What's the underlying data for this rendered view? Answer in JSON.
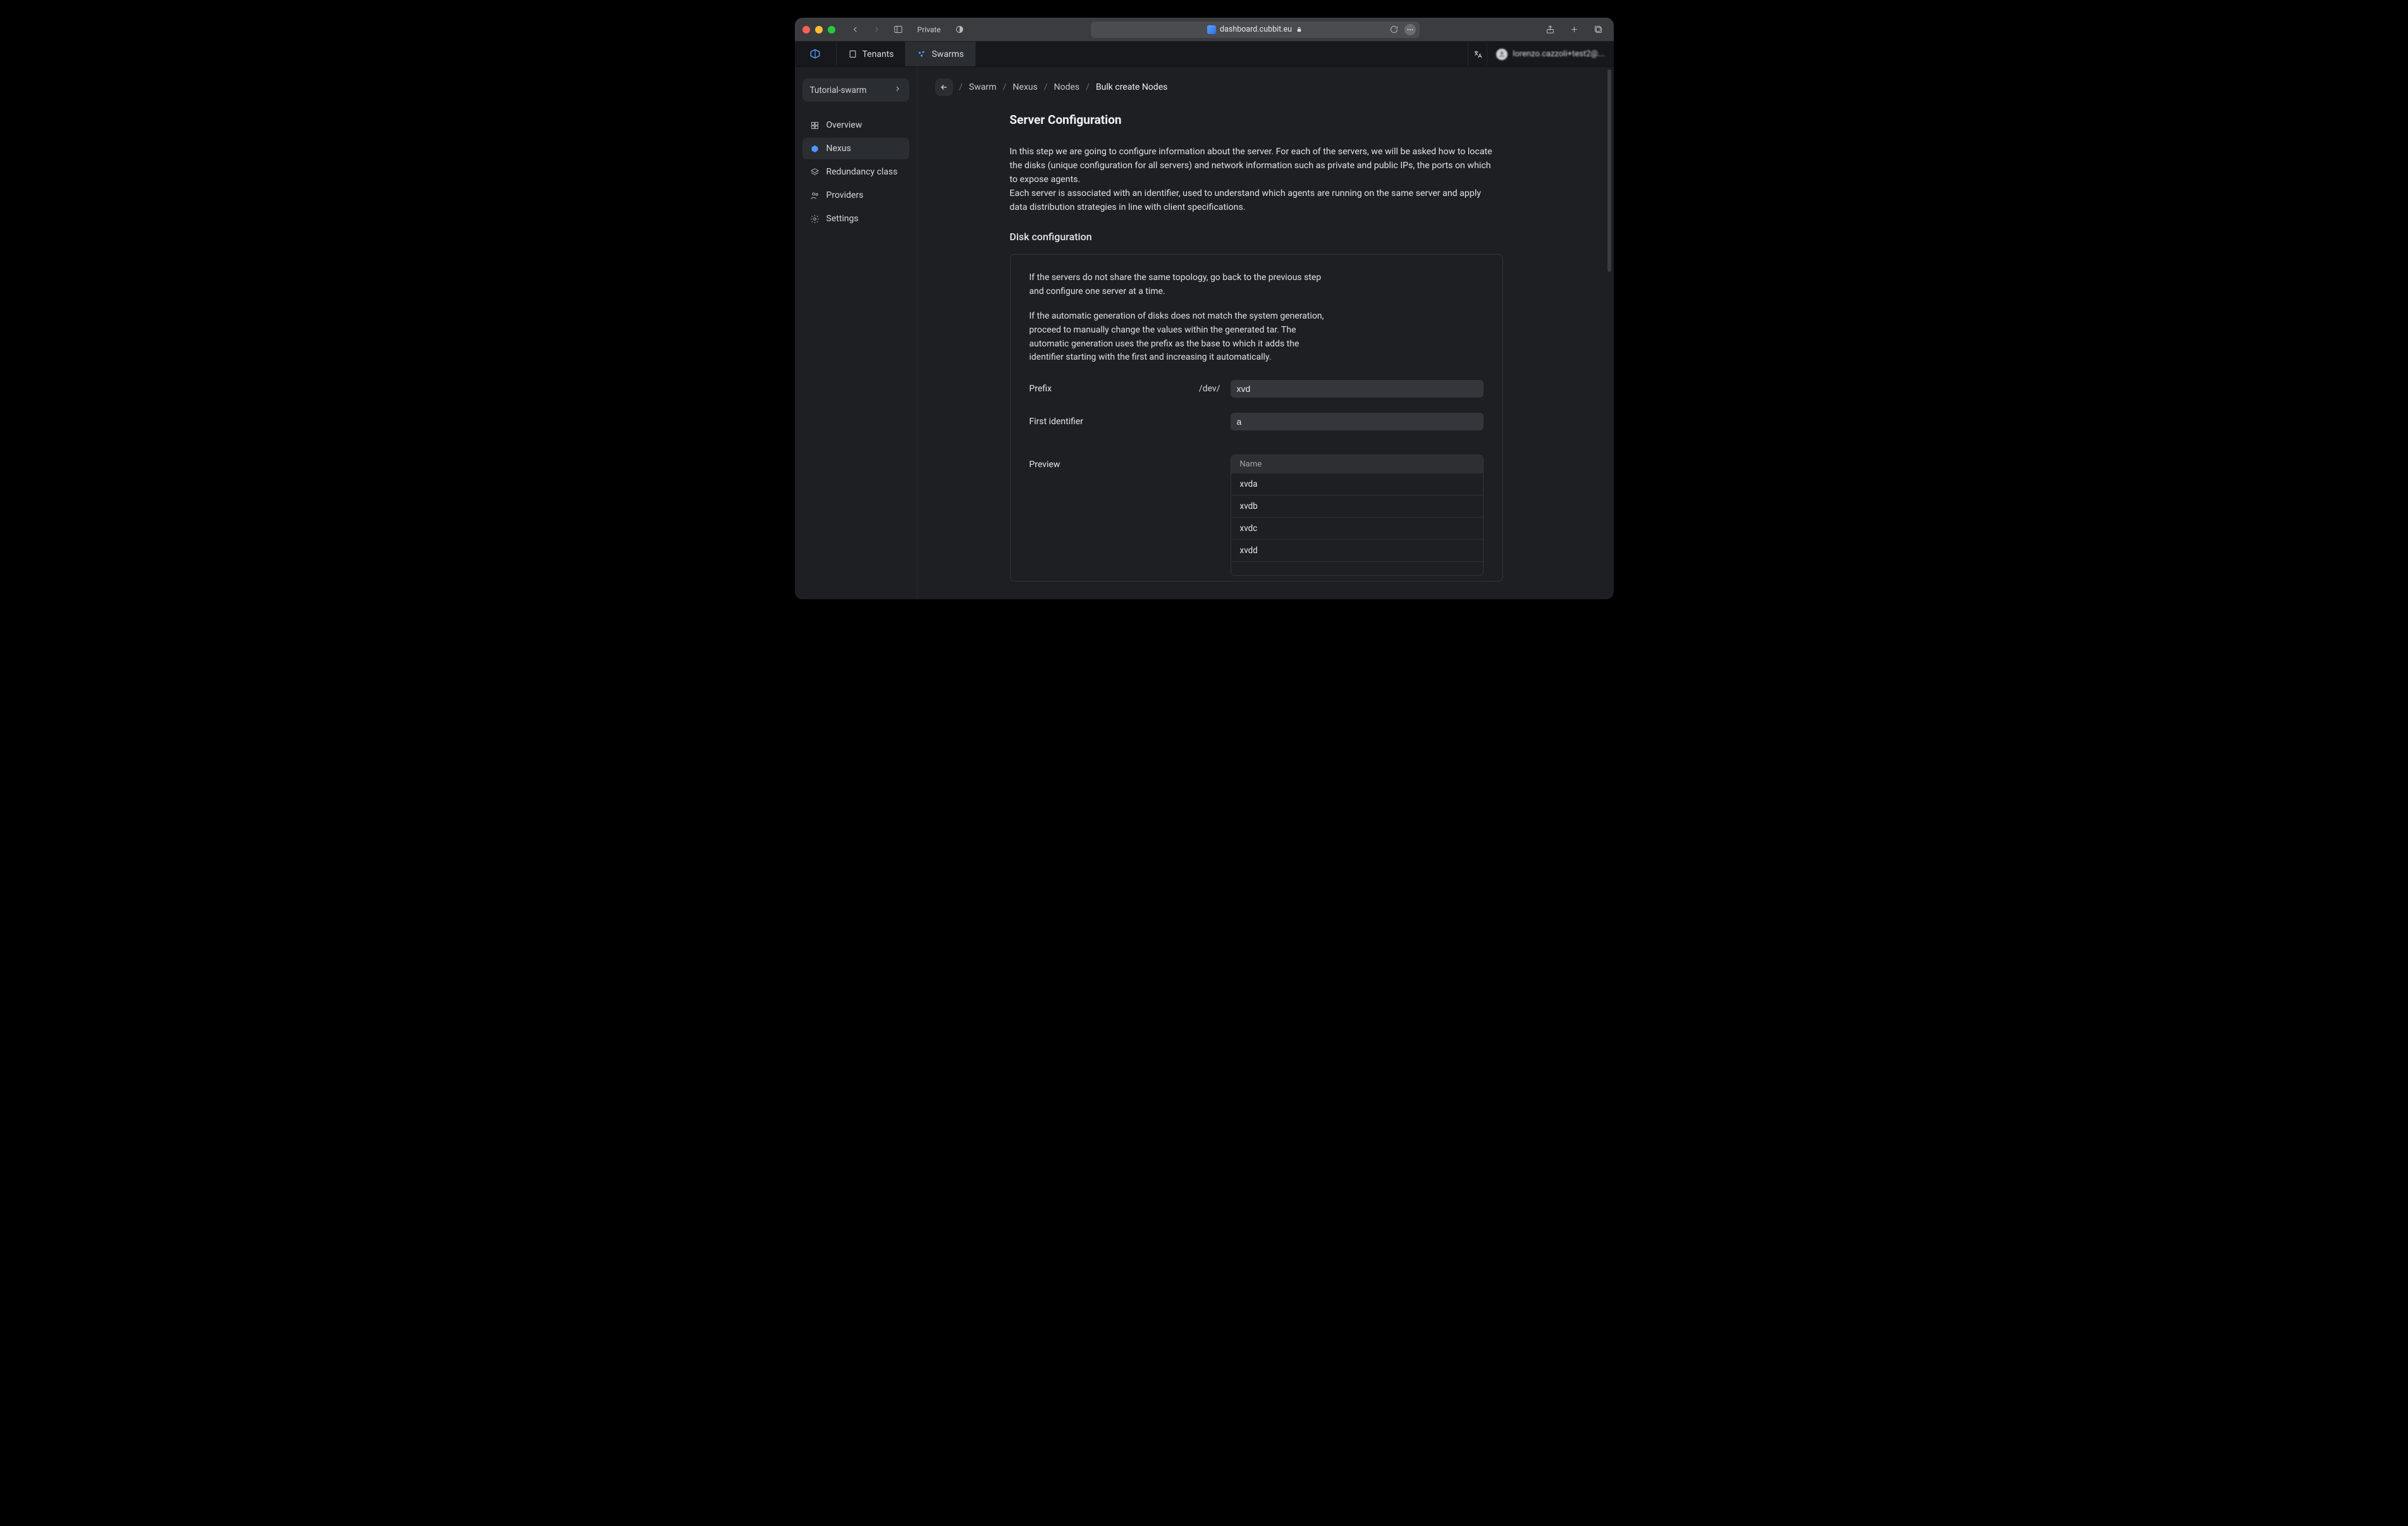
{
  "browser": {
    "private_label": "Private",
    "url_host": "dashboard.cubbit.eu"
  },
  "topnav": {
    "tabs": [
      {
        "label": "Tenants"
      },
      {
        "label": "Swarms"
      }
    ],
    "active_tab_index": 1,
    "user_label": "lorenzo.cazzoli+test2@..."
  },
  "sidebar": {
    "swarm_switch_label": "Tutorial-swarm",
    "items": [
      {
        "label": "Overview"
      },
      {
        "label": "Nexus"
      },
      {
        "label": "Redundancy class"
      },
      {
        "label": "Providers"
      },
      {
        "label": "Settings"
      }
    ],
    "active_index": 1
  },
  "breadcrumbs": {
    "items": [
      "Swarm",
      "Nexus",
      "Nodes"
    ],
    "current": "Bulk create Nodes"
  },
  "page": {
    "title": "Server Configuration",
    "intro_1": "In this step we are going to configure information about the server. For each of the servers, we will be asked how to locate the disks (unique configuration for all servers) and network information such as private and public IPs, the ports on which to expose agents.",
    "intro_2": "Each server is associated with an identifier, used to understand which agents are running on the same server and apply data distribution strategies in line with client specifications.",
    "disk_config_title": "Disk configuration",
    "card_p1": "If the servers do not share the same topology, go back to the previous step and configure one server at a time.",
    "card_p2": "If the automatic generation of disks does not match the system generation, proceed to manually change the values within the generated tar. The automatic generation uses the prefix as the base to which it adds the identifier starting with the first and increasing it automatically.",
    "prefix_label": "Prefix",
    "prefix_static": "/dev/",
    "prefix_value": "xvd",
    "first_id_label": "First identifier",
    "first_id_value": "a",
    "preview_label": "Preview",
    "preview_header": "Name",
    "preview_rows": [
      "xvda",
      "xvdb",
      "xvdc",
      "xvdd"
    ]
  }
}
